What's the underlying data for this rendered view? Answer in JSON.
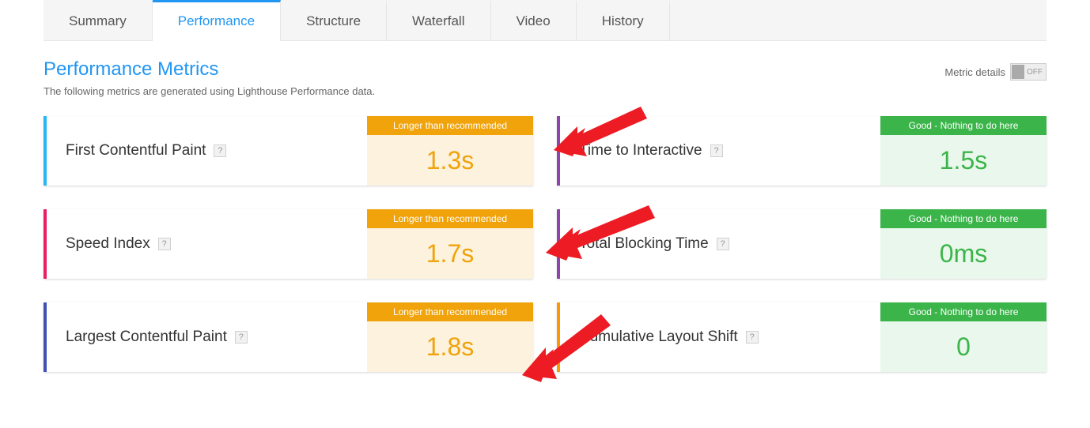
{
  "tabs": {
    "items": [
      {
        "label": "Summary"
      },
      {
        "label": "Performance"
      },
      {
        "label": "Structure"
      },
      {
        "label": "Waterfall"
      },
      {
        "label": "Video"
      },
      {
        "label": "History"
      }
    ],
    "activeIndex": 1
  },
  "section": {
    "title": "Performance Metrics",
    "subtitle": "The following metrics are generated using Lighthouse Performance data."
  },
  "toggle": {
    "label": "Metric details",
    "state": "OFF"
  },
  "status_labels": {
    "warn": "Longer than recommended",
    "good": "Good - Nothing to do here"
  },
  "metrics": [
    {
      "name": "First Contentful Paint",
      "value": "1.3s",
      "status": "warn",
      "stripe": "#29b6f6"
    },
    {
      "name": "Time to Interactive",
      "value": "1.5s",
      "status": "good",
      "stripe": "#8e44ad"
    },
    {
      "name": "Speed Index",
      "value": "1.7s",
      "status": "warn",
      "stripe": "#e91e63"
    },
    {
      "name": "Total Blocking Time",
      "value": "0ms",
      "status": "good",
      "stripe": "#8e44ad"
    },
    {
      "name": "Largest Contentful Paint",
      "value": "1.8s",
      "status": "warn",
      "stripe": "#3f51b5"
    },
    {
      "name": "Cumulative Layout Shift",
      "value": "0",
      "status": "good",
      "stripe": "#ff9800"
    }
  ],
  "help_char": "?"
}
